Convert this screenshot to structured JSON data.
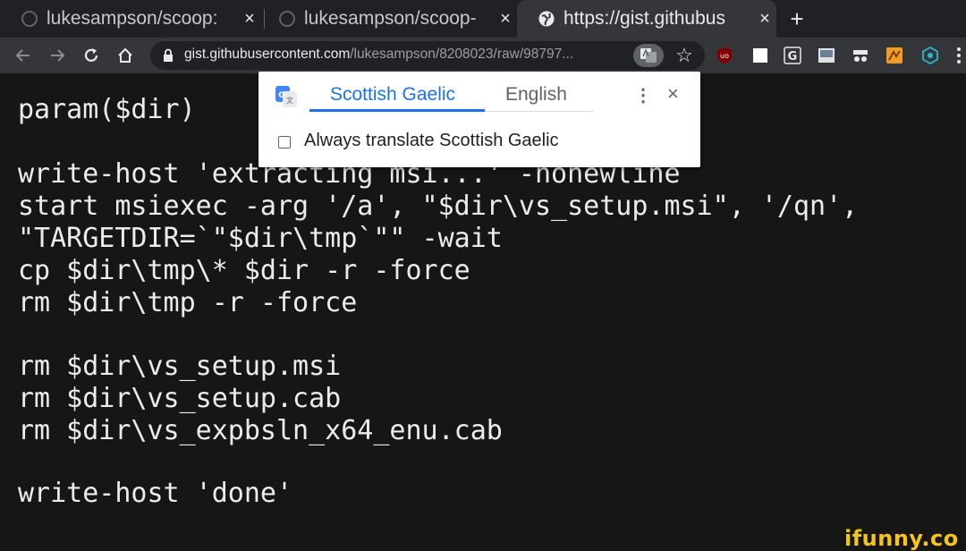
{
  "tabs": [
    {
      "title": "lukesampson/scoop:",
      "close": "×",
      "active": false,
      "icon": "github-icon"
    },
    {
      "title": "lukesampson/scoop-",
      "close": "×",
      "active": false,
      "icon": "github-icon"
    },
    {
      "title": "https://gist.githubus",
      "close": "×",
      "active": true,
      "icon": "globe-icon"
    }
  ],
  "new_tab": "+",
  "address_bar": {
    "host": "gist.githubusercontent.com",
    "path": "/lukesampson/8208023/raw/98797..."
  },
  "code_lines": [
    "param($dir)",
    "write-host 'extracting msi...' -nonewline",
    "start msiexec -arg '/a', \"$dir\\vs_setup.msi\", '/qn',",
    "\"TARGETDIR=`\"$dir\\tmp`\"\" -wait",
    "cp $dir\\tmp\\* $dir -r -force",
    "rm $dir\\tmp -r -force",
    "rm $dir\\vs_setup.msi",
    "rm $dir\\vs_setup.cab",
    "rm $dir\\vs_expbsln_x64_enu.cab",
    "write-host 'done'"
  ],
  "translate_popup": {
    "source_language": "Scottish Gaelic",
    "target_language": "English",
    "menu": "⋮",
    "close": "×",
    "always_translate": "Always translate Scottish Gaelic",
    "always_checked": false
  },
  "watermark": "ifunny.co",
  "colors": {
    "tabstrip": "#202124",
    "toolbar": "#35363a",
    "page_bg": "#161616",
    "accent": "#1a73e8",
    "watermark": "#f5c518"
  }
}
